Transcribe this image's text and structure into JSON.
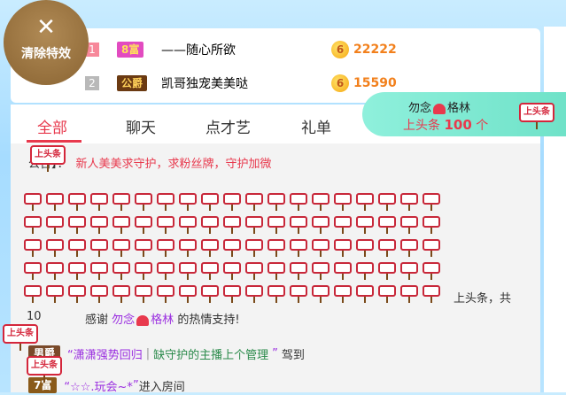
{
  "clear_effects": {
    "label": "清除特效",
    "icon": "close-icon"
  },
  "ranking": [
    {
      "rank": "1",
      "level": "8富",
      "name": "——随心所欲",
      "score": "22222",
      "coin": "6"
    },
    {
      "rank": "2",
      "level": "公爵",
      "name": "凯哥独宠美美哒",
      "score": "15590",
      "coin": "6"
    }
  ],
  "tabs": [
    "全部",
    "聊天",
    "点才艺",
    "礼单"
  ],
  "notice": {
    "label": "公告】：",
    "text": "新人美美求守护，求粉丝牌，守护加微"
  },
  "headline_banner": {
    "user_left": "勿念",
    "user_right": "格林",
    "text": "上头条",
    "count": "100",
    "unit": "个"
  },
  "flag_text": "上头条",
  "headline_msg": {
    "suffix": "上头条，共",
    "prefix": "10"
  },
  "thanks": {
    "pre": "感谢",
    "user_left": "勿念",
    "user_right": "格林",
    "post": "的热情支持!"
  },
  "messages": [
    {
      "level": "男爵",
      "level_color": "#7a4a2a",
      "name": "“潇潇强势回归",
      "sep": "|",
      "text": "缺守护的主播上个管理",
      "close": "”",
      "action": "驾到"
    },
    {
      "level": "7富",
      "level_color": "#8a5a1a",
      "name": "“☆☆.玩会~*",
      "sep": "",
      "text": "",
      "close": "”",
      "action": "进入房间"
    }
  ],
  "colors": {
    "accent": "#e8394d",
    "score": "#f2801c",
    "purple": "#9a2ee0",
    "headline": "#6fe2c8"
  }
}
